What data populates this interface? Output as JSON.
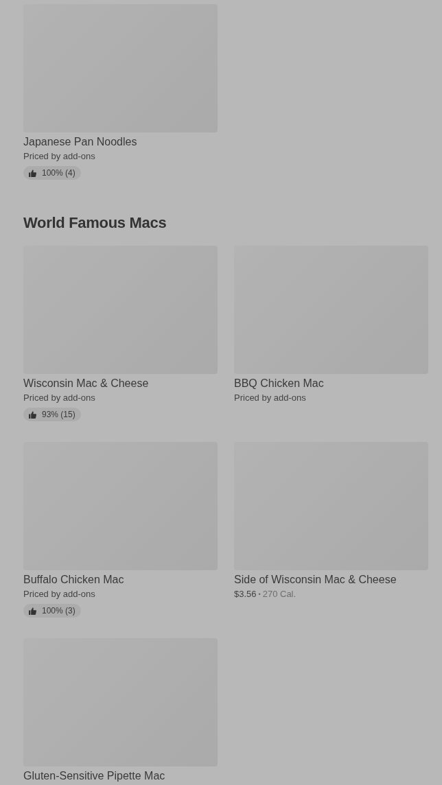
{
  "sections": [
    {
      "items": [
        {
          "name": "Japanese Pan Noodles",
          "price": "Priced by add-ons",
          "rating": "100% (4)"
        }
      ]
    },
    {
      "title": "World Famous Macs",
      "items": [
        {
          "name": "Wisconsin Mac & Cheese",
          "price": "Priced by add-ons",
          "rating": "93% (15)"
        },
        {
          "name": "BBQ Chicken Mac",
          "price": "Priced by add-ons"
        },
        {
          "name": "Buffalo Chicken Mac",
          "price": "Priced by add-ons",
          "rating": "100% (3)"
        },
        {
          "name": "Side of Wisconsin Mac & Cheese",
          "price": "$3.56",
          "separator": "•",
          "calories": "270 Cal."
        },
        {
          "name": "Gluten-Sensitive Pipette Mac"
        }
      ]
    }
  ]
}
